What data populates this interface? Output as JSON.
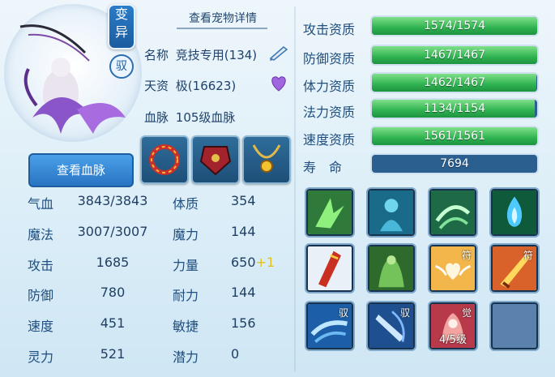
{
  "pet": {
    "variant_badge": [
      "变",
      "异"
    ],
    "ride_badge": "驭",
    "view_details": "查看宠物详情",
    "name_label": "名称",
    "name_value": "竞技专用(134)",
    "talent_label": "天资",
    "talent_value": "极(16623)",
    "bloodline_label": "血脉",
    "bloodline_value": "105级血脉",
    "bloodline_button": "查看血脉"
  },
  "stats": [
    {
      "label": "气血",
      "value": "3843/3843"
    },
    {
      "label": "魔法",
      "value": "3007/3007"
    },
    {
      "label": "攻击",
      "value": "1685"
    },
    {
      "label": "防御",
      "value": "780"
    },
    {
      "label": "速度",
      "value": "451"
    },
    {
      "label": "灵力",
      "value": "521"
    }
  ],
  "attributes": [
    {
      "label": "体质",
      "value": "354",
      "bonus": ""
    },
    {
      "label": "魔力",
      "value": "144",
      "bonus": ""
    },
    {
      "label": "力量",
      "value": "650",
      "bonus": "+1"
    },
    {
      "label": "耐力",
      "value": "144",
      "bonus": ""
    },
    {
      "label": "敏捷",
      "value": "156",
      "bonus": ""
    },
    {
      "label": "潜力",
      "value": "0",
      "bonus": ""
    }
  ],
  "aptitudes": [
    {
      "label": "攻击资质",
      "text": "1574/1574",
      "fill": 1.0
    },
    {
      "label": "防御资质",
      "text": "1467/1467",
      "fill": 1.0
    },
    {
      "label": "体力资质",
      "text": "1462/1467",
      "fill": 0.997
    },
    {
      "label": "法力资质",
      "text": "1134/1154",
      "fill": 0.983
    },
    {
      "label": "速度资质",
      "text": "1561/1561",
      "fill": 1.0
    }
  ],
  "life": {
    "label": "寿　命",
    "value": "7694"
  },
  "skills": {
    "ride_tag": "驭",
    "charm_tag": "符",
    "awaken_tag": "觉",
    "awaken_level": "4/5级"
  },
  "colors": {
    "accent": "#2a74c3",
    "bar_fill": "#2fb251",
    "bonus": "#e2c21a"
  }
}
